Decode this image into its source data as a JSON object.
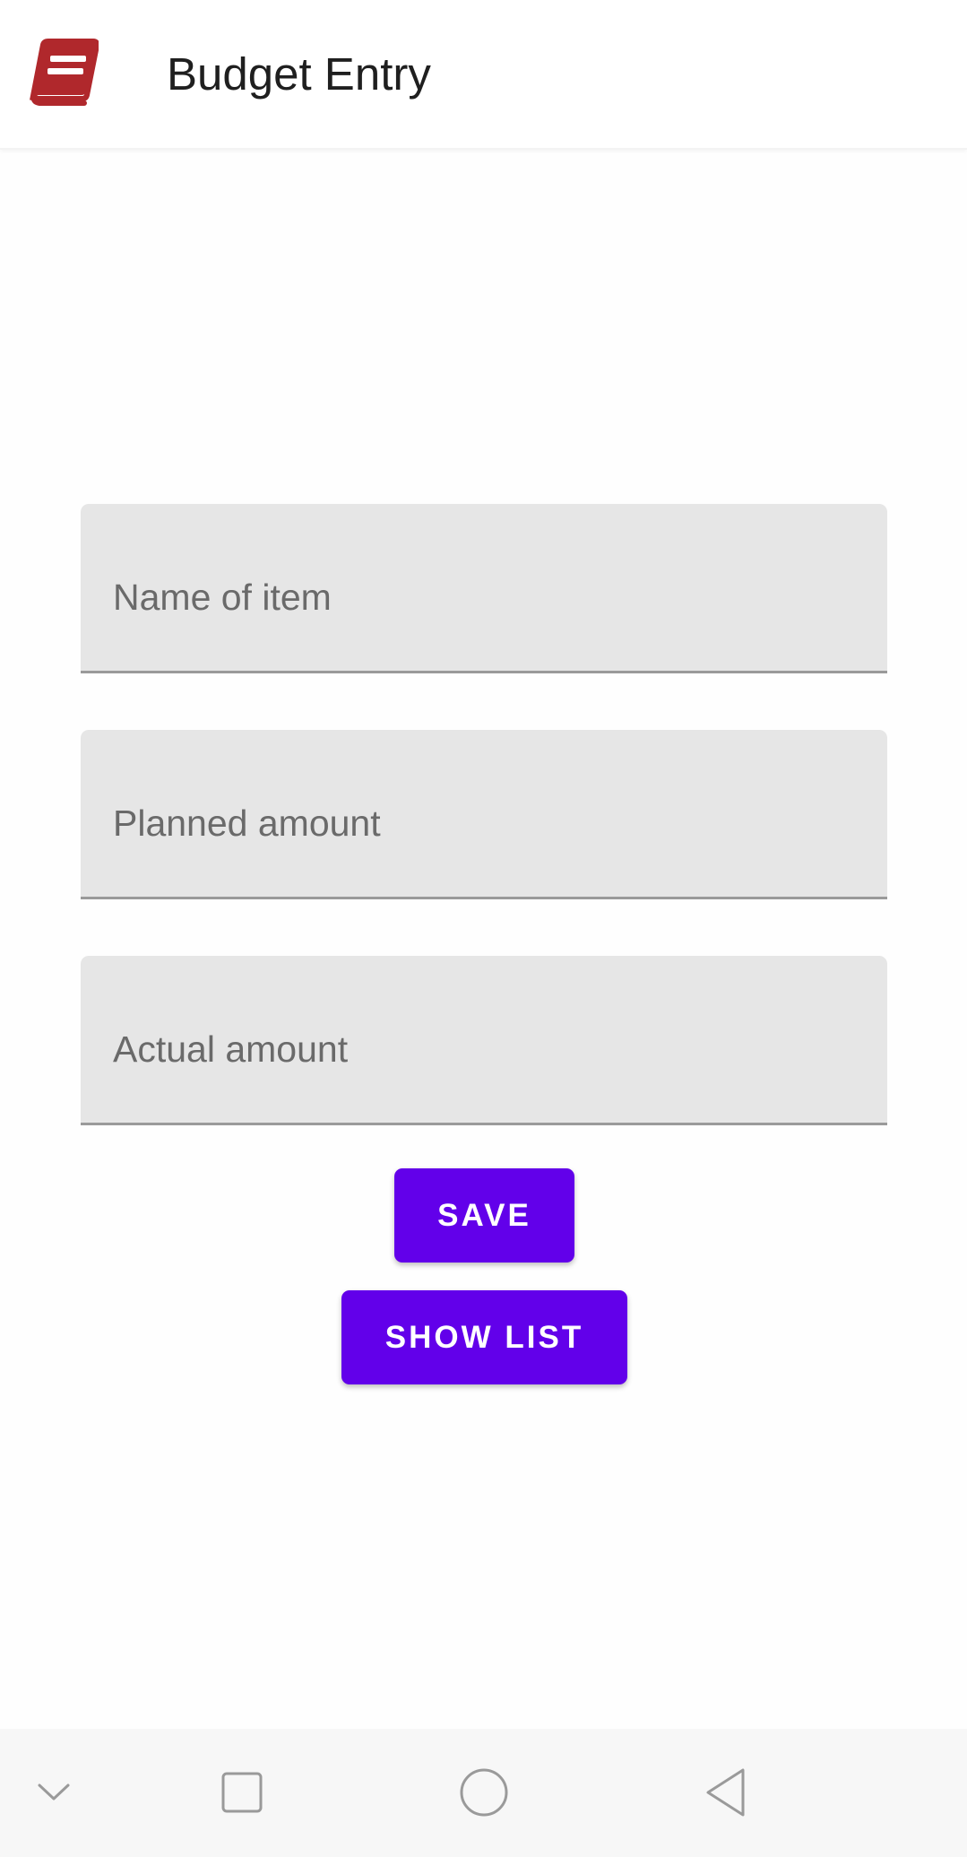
{
  "app_bar": {
    "title": "Budget Entry",
    "icon": "book-icon",
    "icon_color": "#b0282c"
  },
  "form": {
    "fields": [
      {
        "placeholder": "Name of item",
        "value": ""
      },
      {
        "placeholder": "Planned amount",
        "value": ""
      },
      {
        "placeholder": "Actual amount",
        "value": ""
      }
    ],
    "field_background": "#e6e6e6"
  },
  "buttons": {
    "save_label": "SAVE",
    "show_list_label": "SHOW LIST",
    "color": "#6200ea"
  },
  "nav_bar": {
    "items": [
      "chevron-down-icon",
      "recents-square-icon",
      "home-circle-icon",
      "back-triangle-icon"
    ]
  }
}
